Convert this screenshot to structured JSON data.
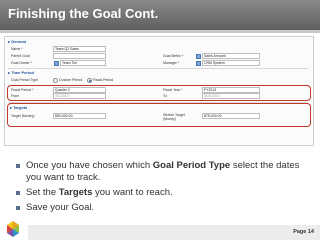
{
  "slide": {
    "title": "Finishing the Goal Cont.",
    "page": "Page 14"
  },
  "form": {
    "general": {
      "section": "▸ General",
      "name_label": "Name *",
      "name_value": "Team Q2 Sales",
      "parent_goal_label": "Parent Goal",
      "parent_goal_value": "",
      "goal_owner_label": "Goal Owner *",
      "goal_owner_value": "Team Tim",
      "goal_metric_label": "Goal Metric *",
      "goal_metric_value": "Sales Amount",
      "manager_label": "Manager *",
      "manager_value": "CRM System"
    },
    "time_period": {
      "section": "▸ Time Period",
      "goal_period_type_label": "Goal Period Type",
      "custom_label": "Custom Period",
      "fiscal_label": "Fiscal Period",
      "fiscal_period_label": "Fiscal Period *",
      "fiscal_period_value": "Quarter 2",
      "fiscal_year_label": "Fiscal Year *",
      "fiscal_year_value": "FY2013",
      "from_label": "From",
      "from_value": "4/1/2013",
      "to_label": "To",
      "to_value": "6/30/2013"
    },
    "targets": {
      "section": "▸ Targets",
      "target_money_label": "Target (Money)",
      "target_money_value": "$50,000.00",
      "stretch_label": "Stretch Target (Money)",
      "stretch_value": "$75,000.00"
    }
  },
  "bullets": {
    "b1_pre": "Once you have chosen which ",
    "b1_bold": "Goal Period Type",
    "b1_post": " select the dates you want to track.",
    "b2_pre": "Set the ",
    "b2_bold": "Targets",
    "b2_post": " you want to reach.",
    "b3": "Save your Goal."
  },
  "colors": {
    "title_bar": "#6f6f6f",
    "highlight": "#c0392b",
    "section": "#1f4e9a"
  }
}
